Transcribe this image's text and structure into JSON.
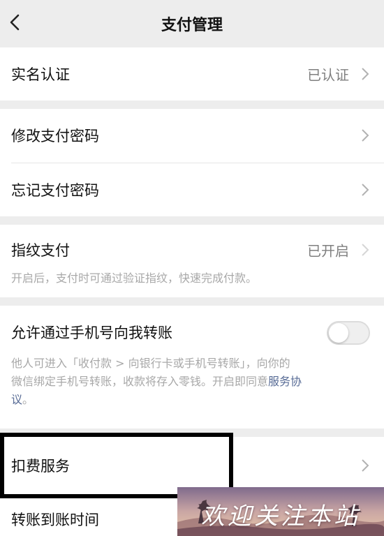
{
  "header": {
    "title": "支付管理",
    "back_icon": "back-chevron-icon"
  },
  "identity": {
    "label": "实名认证",
    "value": "已认证"
  },
  "password": {
    "change_label": "修改支付密码",
    "forgot_label": "忘记支付密码"
  },
  "fingerprint": {
    "label": "指纹支付",
    "value": "已开启",
    "desc": "开启后，支付时可通过验证指纹，快速完成付款。"
  },
  "phone_transfer": {
    "label": "允许通过手机号向我转账",
    "enabled": false,
    "desc_line1": "他人可进入「收付款 > 向银行卡或手机号转账」，向你的",
    "desc_line2_prefix": "微信绑定手机号转账，收款将存入零钱。开启即同意",
    "desc_link_part1": "服务协",
    "desc_link_part2": "议",
    "desc_line3_suffix": "。"
  },
  "deduction": {
    "label": "扣费服务"
  },
  "arrival": {
    "label": "转账到账时间"
  },
  "watermark": {
    "text": "欢迎关注本站"
  },
  "colors": {
    "background": "#ededed",
    "card": "#ffffff",
    "hint_text": "#a8a8a8",
    "value_text": "#7f7f7f",
    "link": "#576b95",
    "highlight_border": "#000000"
  }
}
